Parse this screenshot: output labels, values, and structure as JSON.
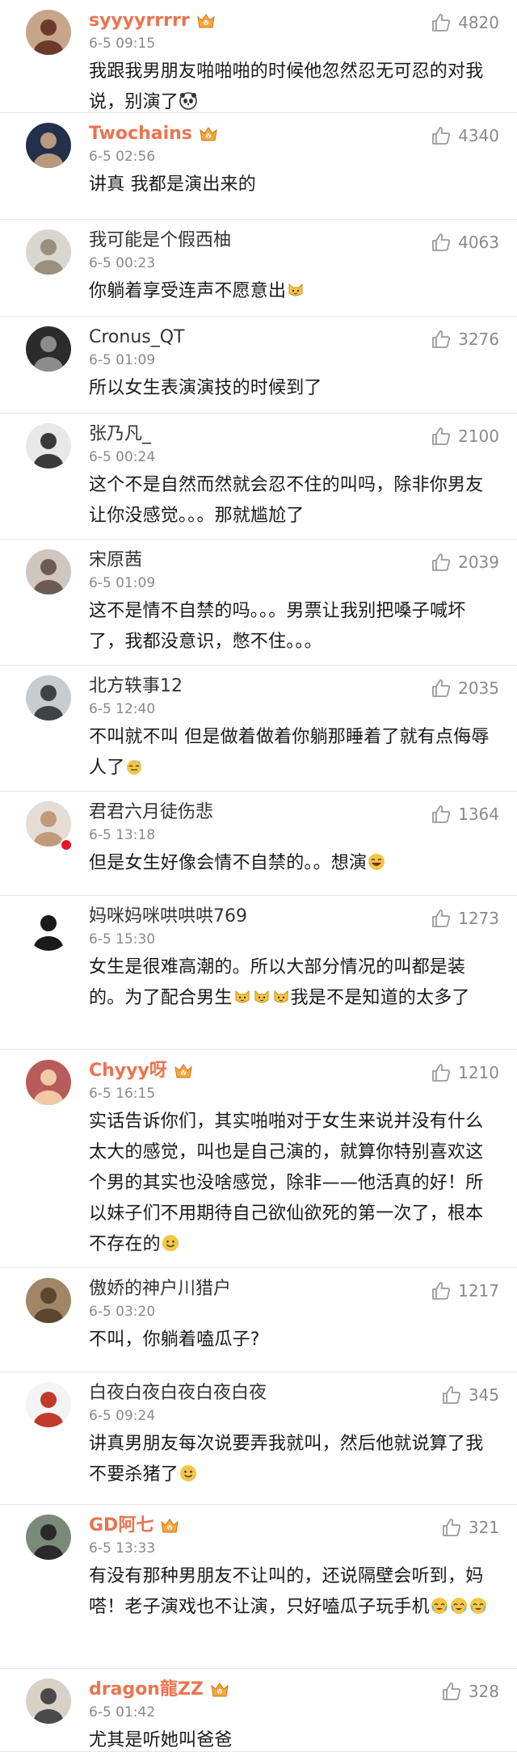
{
  "comments": [
    {
      "name": "syyyyrrrrr",
      "vip": true,
      "time": "6-5 09:15",
      "likes": "4820",
      "segments": [
        {
          "t": "我跟我男朋友啪啪啪的时候他忽然忍无可忍的对我说，别演了"
        },
        {
          "e": "panda-emoji"
        }
      ],
      "avatar": {
        "bg": "#c8a48a",
        "fg": "#6a3b2a"
      }
    },
    {
      "name": "Twochains",
      "vip": true,
      "time": "6-5 02:56",
      "likes": "4340",
      "segments": [
        {
          "t": "讲真 我都是演出来的"
        }
      ],
      "avatar": {
        "bg": "#243049",
        "fg": "#b99a7f"
      }
    },
    {
      "name": "我可能是个假西柚",
      "vip": false,
      "time": "6-5 00:23",
      "likes": "4063",
      "segments": [
        {
          "t": "你躺着享受连声不愿意出"
        },
        {
          "e": "cat-emoji"
        }
      ],
      "avatar": {
        "bg": "#d9d6cf",
        "fg": "#9a8f7d"
      }
    },
    {
      "name": "Cronus_QT",
      "vip": false,
      "time": "6-5 01:09",
      "likes": "3276",
      "segments": [
        {
          "t": "所以女生表演演技的时候到了"
        }
      ],
      "avatar": {
        "bg": "#2b2b2b",
        "fg": "#8c8c8c"
      }
    },
    {
      "name": "张乃凡_",
      "vip": false,
      "time": "6-5 00:24",
      "likes": "2100",
      "segments": [
        {
          "t": "这个不是自然而然就会忍不住的叫吗，除非你男友让你没感觉。。。那就尴尬了"
        }
      ],
      "avatar": {
        "bg": "#e8e8e8",
        "fg": "#3a3a3a"
      }
    },
    {
      "name": "宋原茜",
      "vip": false,
      "time": "6-5 01:09",
      "likes": "2039",
      "segments": [
        {
          "t": "这不是情不自禁的吗。。。男票让我别把嗓子喊坏了，我都没意识，憋不住。。。"
        }
      ],
      "avatar": {
        "bg": "#cfc6c0",
        "fg": "#6b5b55"
      }
    },
    {
      "name": "北方轶事12",
      "vip": false,
      "time": "6-5 12:40",
      "likes": "2035",
      "segments": [
        {
          "t": "不叫就不叫 但是做着做着你躺那睡着了就有点侮辱人了"
        },
        {
          "e": "sweat-emoji"
        }
      ],
      "avatar": {
        "bg": "#c9cccf",
        "fg": "#3e4348"
      }
    },
    {
      "name": "君君六月徒伤悲",
      "vip": false,
      "time": "6-5 13:18",
      "likes": "1364",
      "badge": true,
      "segments": [
        {
          "t": "但是女生好像会情不自禁的。。想演"
        },
        {
          "e": "laugh-emoji"
        }
      ],
      "avatar": {
        "bg": "#e3ddd6",
        "fg": "#c29a7a"
      }
    },
    {
      "name": "妈咪妈咪哄哄哄769",
      "vip": false,
      "time": "6-5 15:30",
      "likes": "1273",
      "segments": [
        {
          "t": "女生是很难高潮的。所以大部分情况的叫都是装的。为了配合男生"
        },
        {
          "e": "cat-emoji"
        },
        {
          "e": "cat-emoji"
        },
        {
          "e": "cat-emoji"
        },
        {
          "t": "我是不是知道的太多了"
        }
      ],
      "avatar": {
        "bg": "#ffffff",
        "fg": "#1a1a1a"
      }
    },
    {
      "name": "Chyyy呀",
      "vip": true,
      "time": "6-5 16:15",
      "likes": "1210",
      "segments": [
        {
          "t": "实话告诉你们，其实啪啪对于女生来说并没有什么太大的感觉，叫也是自己演的，就算你特别喜欢这个男的其实也没啥感觉，除非——他活真的好！所以妹子们不用期待自己欲仙欲死的第一次了，根本不存在的"
        },
        {
          "e": "smile-emoji"
        }
      ],
      "avatar": {
        "bg": "#b85b5b",
        "fg": "#f1c9a5"
      }
    },
    {
      "name": "傲娇的神户川猎户",
      "vip": false,
      "time": "6-5 03:20",
      "likes": "1217",
      "segments": [
        {
          "t": "不叫，你躺着嗑瓜子?"
        }
      ],
      "avatar": {
        "bg": "#a08566",
        "fg": "#5b4630"
      }
    },
    {
      "name": "白夜白夜白夜白夜白夜",
      "vip": false,
      "time": "6-5 09:24",
      "likes": "345",
      "segments": [
        {
          "t": "讲真男朋友每次说要弄我就叫，然后他就说算了我不要杀猪了"
        },
        {
          "e": "smile-emoji"
        }
      ],
      "avatar": {
        "bg": "#f4f4f4",
        "fg": "#c0392b"
      }
    },
    {
      "name": "GD阿七",
      "vip": true,
      "time": "6-5 13:33",
      "likes": "321",
      "segments": [
        {
          "t": "有没有那种男朋友不让叫的，还说隔壁会听到，妈嗒！老子演戏也不让演，只好嗑瓜子玩手机"
        },
        {
          "e": "cry-emoji"
        },
        {
          "e": "cry-emoji"
        },
        {
          "e": "cry-emoji"
        }
      ],
      "avatar": {
        "bg": "#7a8a7a",
        "fg": "#2a2a2a"
      }
    },
    {
      "name": "dragon龍ZZ",
      "vip": true,
      "time": "6-5 01:42",
      "likes": "328",
      "segments": [
        {
          "t": "尤其是听她叫爸爸"
        }
      ],
      "avatar": {
        "bg": "#d8d2c6",
        "fg": "#4a4a4a"
      }
    }
  ]
}
